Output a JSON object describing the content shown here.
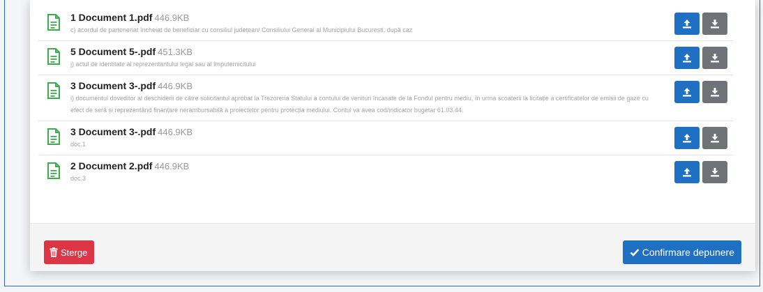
{
  "documents": [
    {
      "name": "1 Document 1.pdf",
      "size": "446.9KB",
      "description": "c) acordul de parteneriat încheiat de beneficiar cu consiliul județean/ Consiliului General al Municipiului București, după caz"
    },
    {
      "name": "5 Document 5-.pdf",
      "size": "451.3KB",
      "description": "j) actul de identitate al reprezentantului legal sau al împuternicitului"
    },
    {
      "name": "3 Document 3-.pdf",
      "size": "446.9KB",
      "description": "i) documentul doveditor al deschiderii de către solicitantul aprobat la Trezoreria Statului a contului de venituri încasate de la Fondul pentru mediu, în urma scoaterii la licitație a certificatelor de emisii de gaze cu efect de seră și reprezentând finanțare nerambursabilă a proiectelor pentru protecția mediului. Contul va avea cod/indicator bugetar 61.03.44."
    },
    {
      "name": "3 Document 3-.pdf",
      "size": "446.9KB",
      "description": "doc.1"
    },
    {
      "name": "2 Document 2.pdf",
      "size": "446.9KB",
      "description": "doc.3"
    }
  ],
  "footer": {
    "delete_label": "Sterge",
    "confirm_label": "Confirmare depunere"
  },
  "colors": {
    "upload_button": "#1f6fc2",
    "download_button": "#6f7378",
    "delete_button": "#dc3545",
    "file_icon": "#3cab4e"
  },
  "icons": {
    "file": "file-text-icon",
    "upload": "upload-icon",
    "download": "download-icon",
    "delete": "trash-icon",
    "confirm": "check-icon"
  }
}
